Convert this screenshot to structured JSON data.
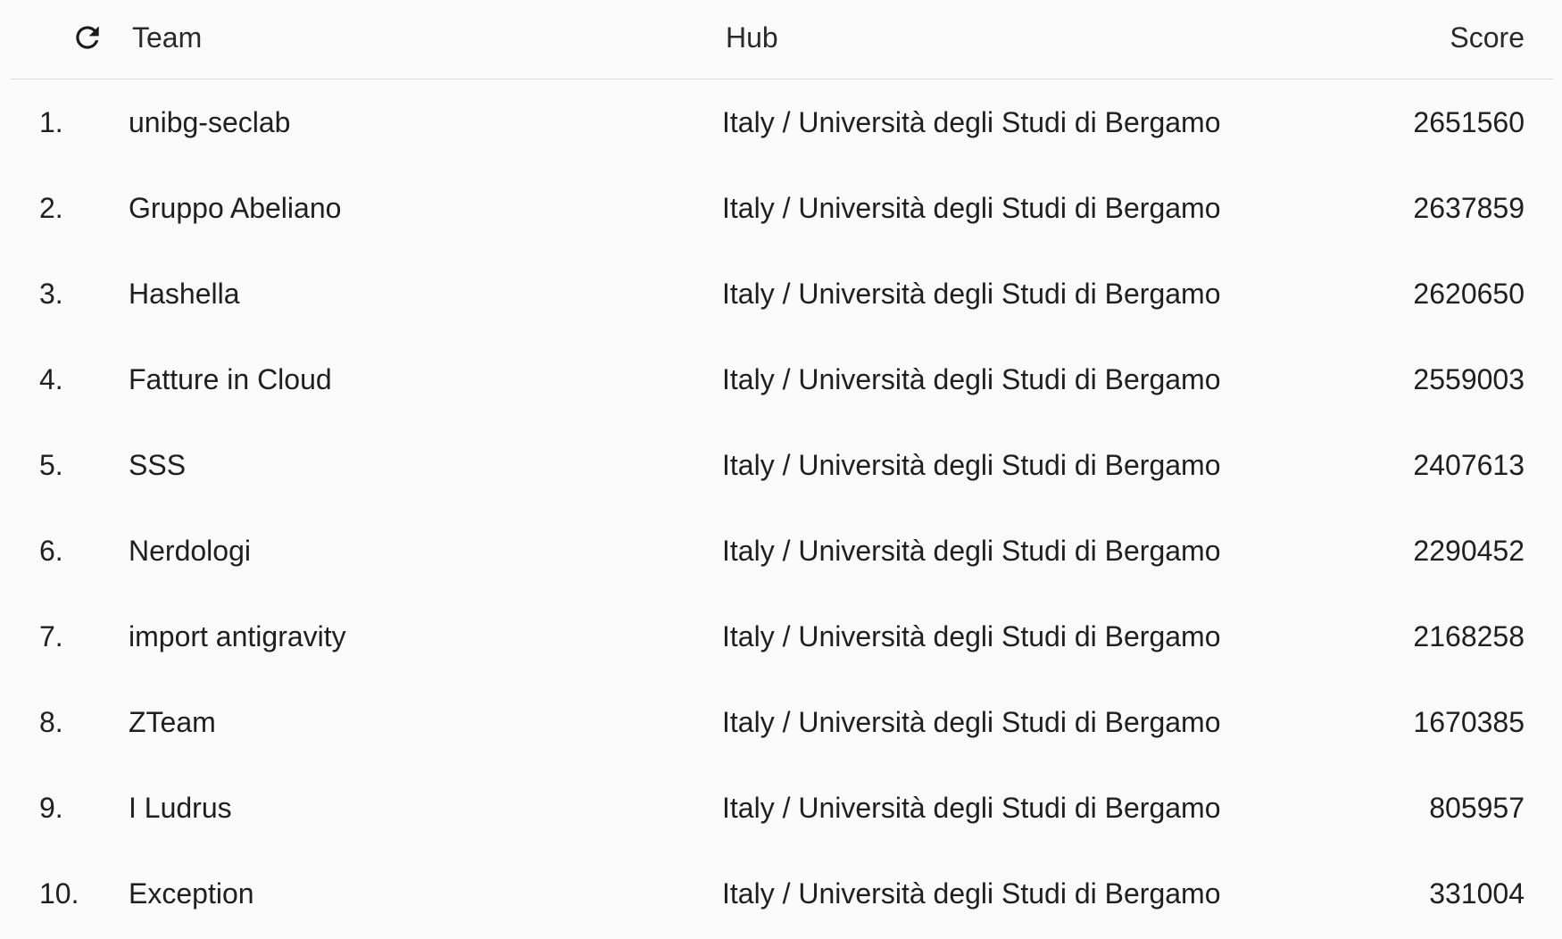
{
  "header": {
    "team_label": "Team",
    "hub_label": "Hub",
    "score_label": "Score",
    "refresh_icon": "refresh-icon"
  },
  "rows": [
    {
      "rank": "1.",
      "team": "unibg-seclab",
      "hub": "Italy / Università degli Studi di Bergamo",
      "score": "2651560"
    },
    {
      "rank": "2.",
      "team": "Gruppo Abeliano",
      "hub": "Italy / Università degli Studi di Bergamo",
      "score": "2637859"
    },
    {
      "rank": "3.",
      "team": "Hashella",
      "hub": "Italy / Università degli Studi di Bergamo",
      "score": "2620650"
    },
    {
      "rank": "4.",
      "team": "Fatture in Cloud",
      "hub": "Italy / Università degli Studi di Bergamo",
      "score": "2559003"
    },
    {
      "rank": "5.",
      "team": "SSS",
      "hub": "Italy / Università degli Studi di Bergamo",
      "score": "2407613"
    },
    {
      "rank": "6.",
      "team": "Nerdologi",
      "hub": "Italy / Università degli Studi di Bergamo",
      "score": "2290452"
    },
    {
      "rank": "7.",
      "team": "import antigravity",
      "hub": "Italy / Università degli Studi di Bergamo",
      "score": "2168258"
    },
    {
      "rank": "8.",
      "team": "ZTeam",
      "hub": "Italy / Università degli Studi di Bergamo",
      "score": "1670385"
    },
    {
      "rank": "9.",
      "team": "I Ludrus",
      "hub": "Italy / Università degli Studi di Bergamo",
      "score": "805957"
    },
    {
      "rank": "10.",
      "team": "Exception",
      "hub": "Italy / Università degli Studi di Bergamo",
      "score": "331004"
    }
  ]
}
